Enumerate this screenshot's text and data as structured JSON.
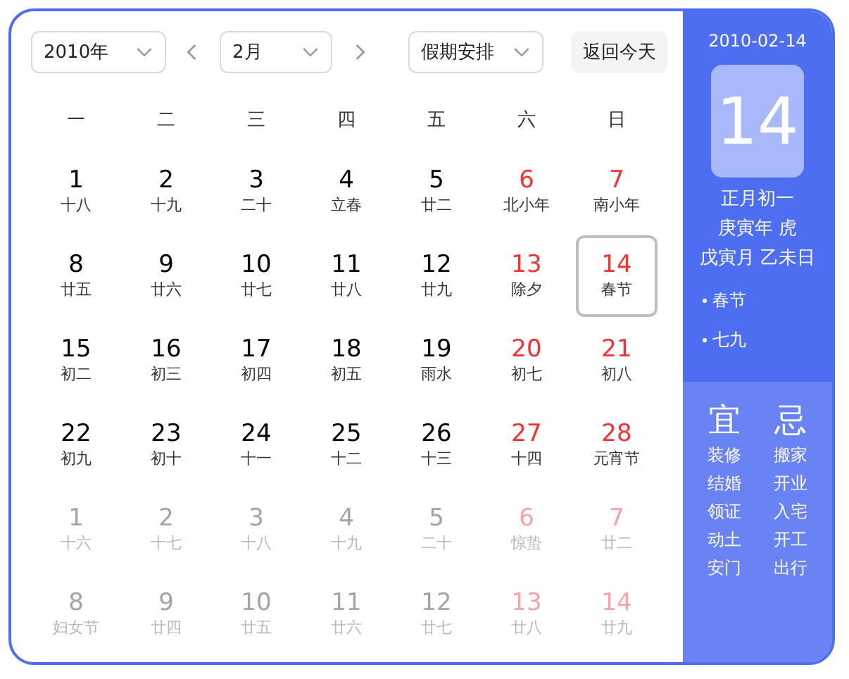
{
  "toolbar": {
    "year": "2010年",
    "month": "2月",
    "holiday": "假期安排",
    "today_button": "返回今天"
  },
  "weekdays": [
    "一",
    "二",
    "三",
    "四",
    "五",
    "六",
    "日"
  ],
  "days": [
    {
      "day": "1",
      "lunar": "十八",
      "red": false,
      "muted": false,
      "selected": false
    },
    {
      "day": "2",
      "lunar": "十九",
      "red": false,
      "muted": false,
      "selected": false
    },
    {
      "day": "3",
      "lunar": "二十",
      "red": false,
      "muted": false,
      "selected": false
    },
    {
      "day": "4",
      "lunar": "立春",
      "red": false,
      "muted": false,
      "selected": false
    },
    {
      "day": "5",
      "lunar": "廿二",
      "red": false,
      "muted": false,
      "selected": false
    },
    {
      "day": "6",
      "lunar": "北小年",
      "red": true,
      "muted": false,
      "selected": false
    },
    {
      "day": "7",
      "lunar": "南小年",
      "red": true,
      "muted": false,
      "selected": false
    },
    {
      "day": "8",
      "lunar": "廿五",
      "red": false,
      "muted": false,
      "selected": false
    },
    {
      "day": "9",
      "lunar": "廿六",
      "red": false,
      "muted": false,
      "selected": false
    },
    {
      "day": "10",
      "lunar": "廿七",
      "red": false,
      "muted": false,
      "selected": false
    },
    {
      "day": "11",
      "lunar": "廿八",
      "red": false,
      "muted": false,
      "selected": false
    },
    {
      "day": "12",
      "lunar": "廿九",
      "red": false,
      "muted": false,
      "selected": false
    },
    {
      "day": "13",
      "lunar": "除夕",
      "red": true,
      "muted": false,
      "selected": false
    },
    {
      "day": "14",
      "lunar": "春节",
      "red": true,
      "muted": false,
      "selected": true
    },
    {
      "day": "15",
      "lunar": "初二",
      "red": false,
      "muted": false,
      "selected": false
    },
    {
      "day": "16",
      "lunar": "初三",
      "red": false,
      "muted": false,
      "selected": false
    },
    {
      "day": "17",
      "lunar": "初四",
      "red": false,
      "muted": false,
      "selected": false
    },
    {
      "day": "18",
      "lunar": "初五",
      "red": false,
      "muted": false,
      "selected": false
    },
    {
      "day": "19",
      "lunar": "雨水",
      "red": false,
      "muted": false,
      "selected": false
    },
    {
      "day": "20",
      "lunar": "初七",
      "red": true,
      "muted": false,
      "selected": false
    },
    {
      "day": "21",
      "lunar": "初八",
      "red": true,
      "muted": false,
      "selected": false
    },
    {
      "day": "22",
      "lunar": "初九",
      "red": false,
      "muted": false,
      "selected": false
    },
    {
      "day": "23",
      "lunar": "初十",
      "red": false,
      "muted": false,
      "selected": false
    },
    {
      "day": "24",
      "lunar": "十一",
      "red": false,
      "muted": false,
      "selected": false
    },
    {
      "day": "25",
      "lunar": "十二",
      "red": false,
      "muted": false,
      "selected": false
    },
    {
      "day": "26",
      "lunar": "十三",
      "red": false,
      "muted": false,
      "selected": false
    },
    {
      "day": "27",
      "lunar": "十四",
      "red": true,
      "muted": false,
      "selected": false
    },
    {
      "day": "28",
      "lunar": "元宵节",
      "red": true,
      "muted": false,
      "selected": false
    },
    {
      "day": "1",
      "lunar": "十六",
      "red": false,
      "muted": true,
      "selected": false
    },
    {
      "day": "2",
      "lunar": "十七",
      "red": false,
      "muted": true,
      "selected": false
    },
    {
      "day": "3",
      "lunar": "十八",
      "red": false,
      "muted": true,
      "selected": false
    },
    {
      "day": "4",
      "lunar": "十九",
      "red": false,
      "muted": true,
      "selected": false
    },
    {
      "day": "5",
      "lunar": "二十",
      "red": false,
      "muted": true,
      "selected": false
    },
    {
      "day": "6",
      "lunar": "惊蛰",
      "red": true,
      "muted": true,
      "selected": false
    },
    {
      "day": "7",
      "lunar": "廿二",
      "red": true,
      "muted": true,
      "selected": false
    },
    {
      "day": "8",
      "lunar": "妇女节",
      "red": false,
      "muted": true,
      "selected": false
    },
    {
      "day": "9",
      "lunar": "廿四",
      "red": false,
      "muted": true,
      "selected": false
    },
    {
      "day": "10",
      "lunar": "廿五",
      "red": false,
      "muted": true,
      "selected": false
    },
    {
      "day": "11",
      "lunar": "廿六",
      "red": false,
      "muted": true,
      "selected": false
    },
    {
      "day": "12",
      "lunar": "廿七",
      "red": false,
      "muted": true,
      "selected": false
    },
    {
      "day": "13",
      "lunar": "廿八",
      "red": true,
      "muted": true,
      "selected": false
    },
    {
      "day": "14",
      "lunar": "廿九",
      "red": true,
      "muted": true,
      "selected": false
    }
  ],
  "detail": {
    "date": "2010-02-14",
    "big_day": "14",
    "lunar_lines": [
      "正月初一",
      "庚寅年 虎",
      "戊寅月 乙未日"
    ],
    "festivals": [
      "春节",
      "七九"
    ],
    "good": {
      "title": "宜",
      "items": [
        "装修",
        "结婚",
        "领证",
        "动土",
        "安门"
      ]
    },
    "bad": {
      "title": "忌",
      "items": [
        "搬家",
        "开业",
        "入宅",
        "开工",
        "出行"
      ]
    }
  }
}
